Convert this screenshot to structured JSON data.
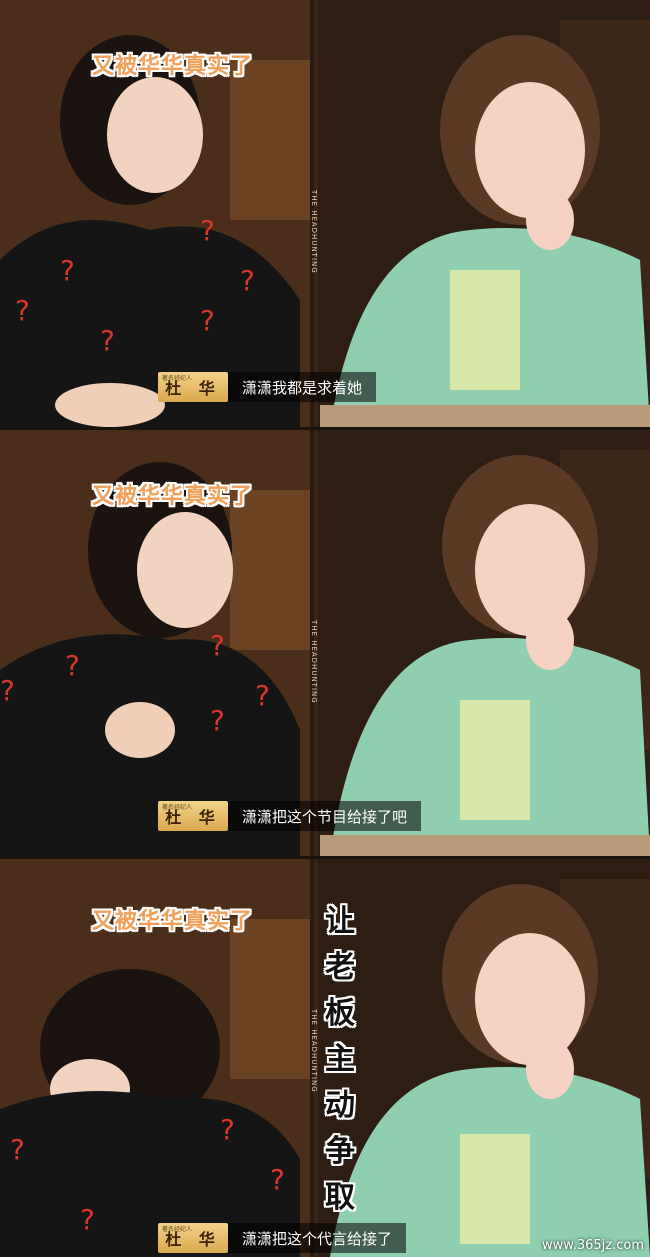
{
  "top_caption": "又被华华真实了",
  "speaker_name": "杜 华",
  "speaker_tag_small": "著名经纪人",
  "show_vertical_label": "THE HEADHUNTING",
  "panels": [
    {
      "subtitle": "潇潇我都是求着她"
    },
    {
      "subtitle": "潇潇把这个节目给接了吧"
    },
    {
      "subtitle": "潇潇把这个代言给接了"
    }
  ],
  "vertical_caption": [
    "让",
    "老",
    "板",
    "主",
    "动",
    "争",
    "取"
  ],
  "watermark": "www.365jz.com",
  "colors": {
    "caption_orange": "#f0a05a",
    "name_tag_gold": "#d9a94e",
    "jacket_green": "#8fcfb0",
    "sweater_black": "#151515",
    "question_mark_red": "#d8362c"
  }
}
